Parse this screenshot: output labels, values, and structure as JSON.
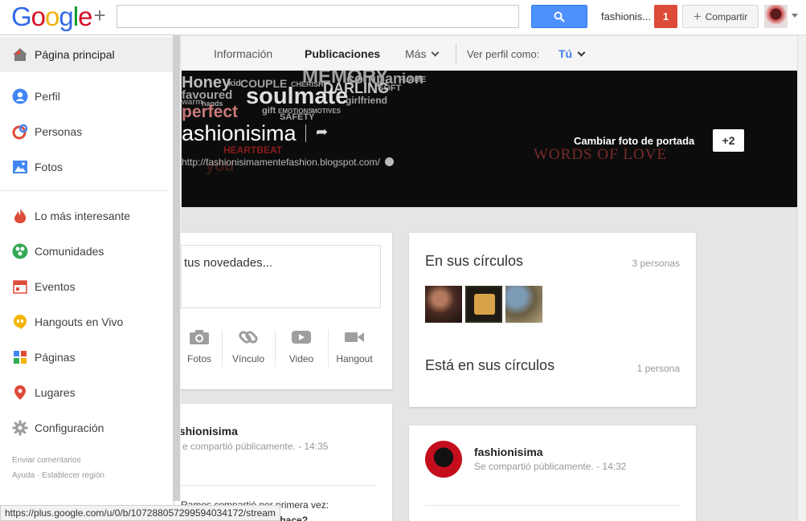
{
  "topbar": {
    "logo": "Google+",
    "search_value": "",
    "user_name": "fashionis...",
    "notifications": "1",
    "share_label": "Compartir"
  },
  "profile_tabs": {
    "items": [
      "Información",
      "Publicaciones",
      "Más"
    ],
    "active": "Publicaciones",
    "view_as_label": "Ver perfil como:",
    "view_as_value": "Tú"
  },
  "cover": {
    "name": "ashionisima",
    "url": "http://fashionisimamentefashion.blogspot.com/",
    "change_cover": "Cambiar foto de portada",
    "plus_one": "+2",
    "cover_words": [
      "MEMORY",
      "Honey",
      "kid",
      "COUPLE",
      "CHERISH",
      "companion",
      "FLAME",
      "DARLING",
      "SOFT",
      "soulmate",
      "favoured",
      "girlfriend",
      "warm",
      "hands",
      "perfect",
      "gift",
      "EMOTIONS",
      "MOTIVES",
      "SAFETY",
      "HEARTBEAT",
      "you"
    ],
    "words_love": "WORDS OF LOVE"
  },
  "sidebar": {
    "items": [
      {
        "label": "Página principal",
        "icon": "home-icon"
      },
      {
        "label": "Perfil",
        "icon": "profile-icon"
      },
      {
        "label": "Personas",
        "icon": "people-icon"
      },
      {
        "label": "Fotos",
        "icon": "photos-icon"
      },
      {
        "label": "Lo más interesante",
        "icon": "trending-icon"
      },
      {
        "label": "Comunidades",
        "icon": "communities-icon"
      },
      {
        "label": "Eventos",
        "icon": "events-icon"
      },
      {
        "label": "Hangouts en Vivo",
        "icon": "hangouts-icon"
      },
      {
        "label": "Páginas",
        "icon": "pages-icon"
      },
      {
        "label": "Lugares",
        "icon": "places-icon"
      },
      {
        "label": "Configuración",
        "icon": "settings-icon"
      }
    ],
    "feedback": "Enviar comentarios",
    "help": "Ayuda",
    "set_region": "Establecer región",
    "footer_sep": "·"
  },
  "composer": {
    "prompt": "tus novedades...",
    "actions": [
      "Fotos",
      "Vínculo",
      "Video",
      "Hangout"
    ]
  },
  "post_left": {
    "name": "ashionisima",
    "meta": "e compartió públicamente.  -  14:35",
    "text": "Ramos compartió por primera vez:",
    "text2": "is hace?"
  },
  "circles": {
    "in_your_circles": "En sus círculos",
    "in_your_circles_count": "3 personas",
    "in_their_circles": "Está en sus círculos",
    "in_their_circles_count": "1 persona"
  },
  "post_right": {
    "name": "fashionisima",
    "meta": "Se compartió públicamente.  -  14:32"
  },
  "statusbar": {
    "url": "https://plus.google.com/u/0/b/107288057299594034172/stream"
  },
  "colors": {
    "accent_blue": "#4d90fe",
    "notif_red": "#dd4b39",
    "view_as_blue": "#427fed"
  }
}
